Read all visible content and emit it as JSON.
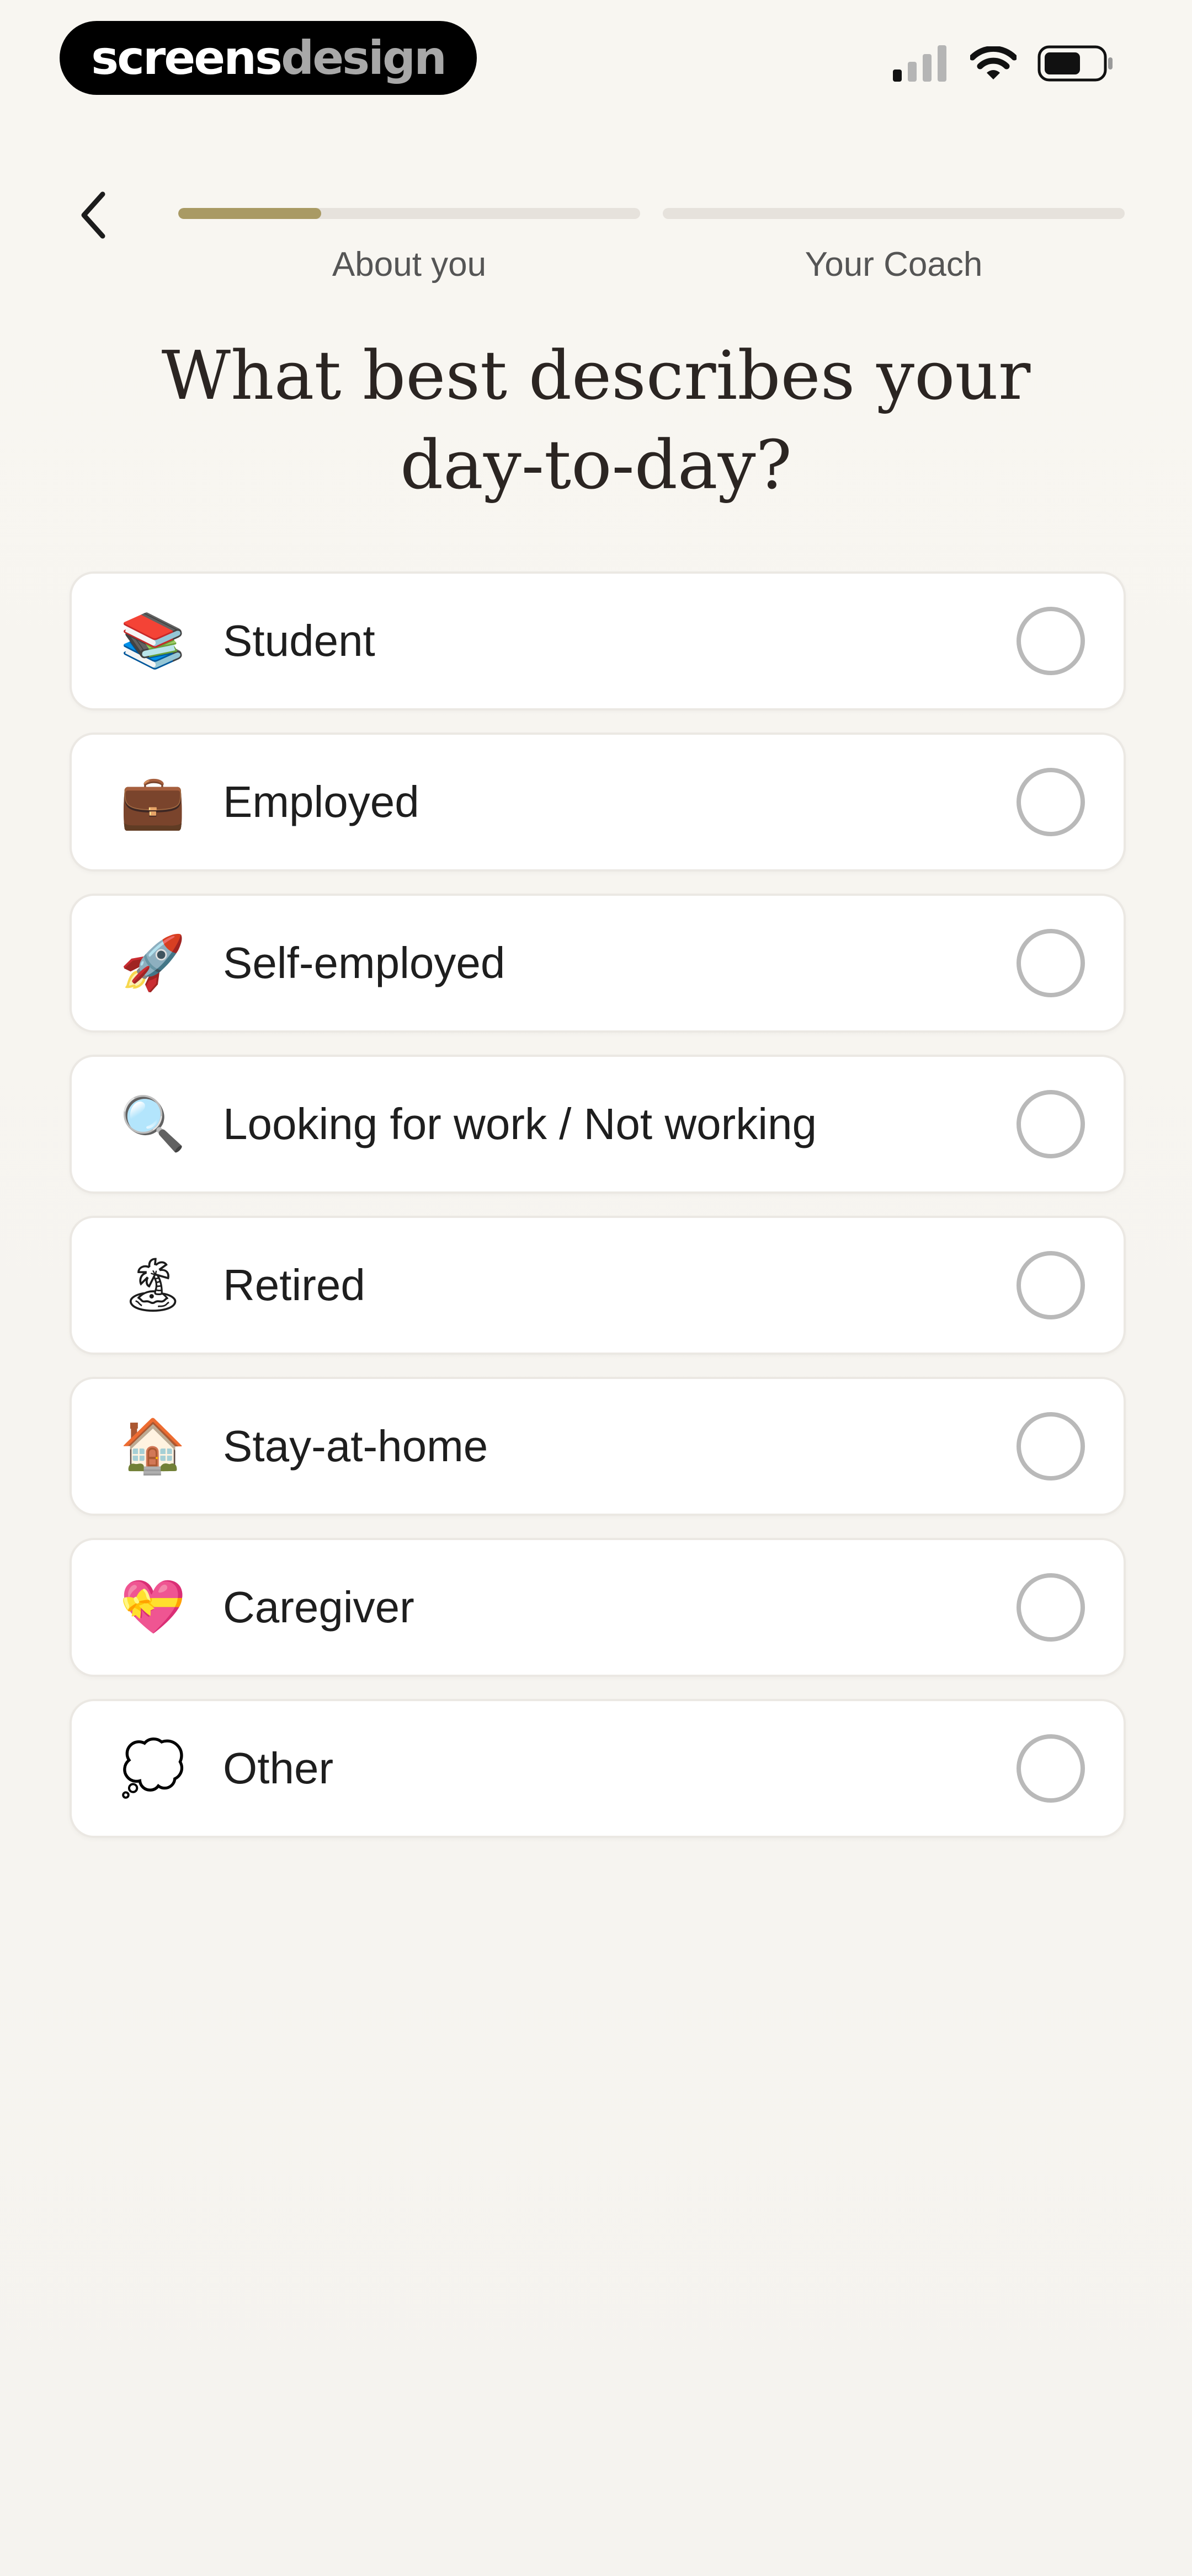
{
  "status_bar": {
    "logo_part1": "screens",
    "logo_part2": "design",
    "icons": [
      "cellular-signal-icon",
      "wifi-icon",
      "battery-icon"
    ]
  },
  "header": {
    "back_icon": "chevron-left-icon",
    "steps": [
      {
        "label": "About you",
        "progress": 0.31
      },
      {
        "label": "Your Coach",
        "progress": 0.0
      }
    ]
  },
  "question": {
    "title": "What best describes your day-to-day?"
  },
  "options": [
    {
      "emoji": "📚",
      "icon": "books-icon",
      "label": "Student",
      "selected": false
    },
    {
      "emoji": "💼",
      "icon": "briefcase-icon",
      "label": "Employed",
      "selected": false
    },
    {
      "emoji": "🚀",
      "icon": "rocket-icon",
      "label": "Self-employed",
      "selected": false
    },
    {
      "emoji": "🔍",
      "icon": "magnifying-glass-icon",
      "label": "Looking for work / Not working",
      "selected": false
    },
    {
      "emoji": "🏝",
      "icon": "island-icon",
      "label": "Retired",
      "selected": false
    },
    {
      "emoji": "🏠",
      "icon": "house-icon",
      "label": "Stay-at-home",
      "selected": false
    },
    {
      "emoji": "💝",
      "icon": "heart-ribbon-icon",
      "label": "Caregiver",
      "selected": false
    },
    {
      "emoji": "💭",
      "icon": "thought-bubble-icon",
      "label": "Other",
      "selected": false
    }
  ],
  "colors": {
    "accent": "#a99a64",
    "track": "#e6e2dc",
    "background": "#f7f5f1",
    "card": "#ffffff",
    "radio_border": "#b9b9b9"
  }
}
